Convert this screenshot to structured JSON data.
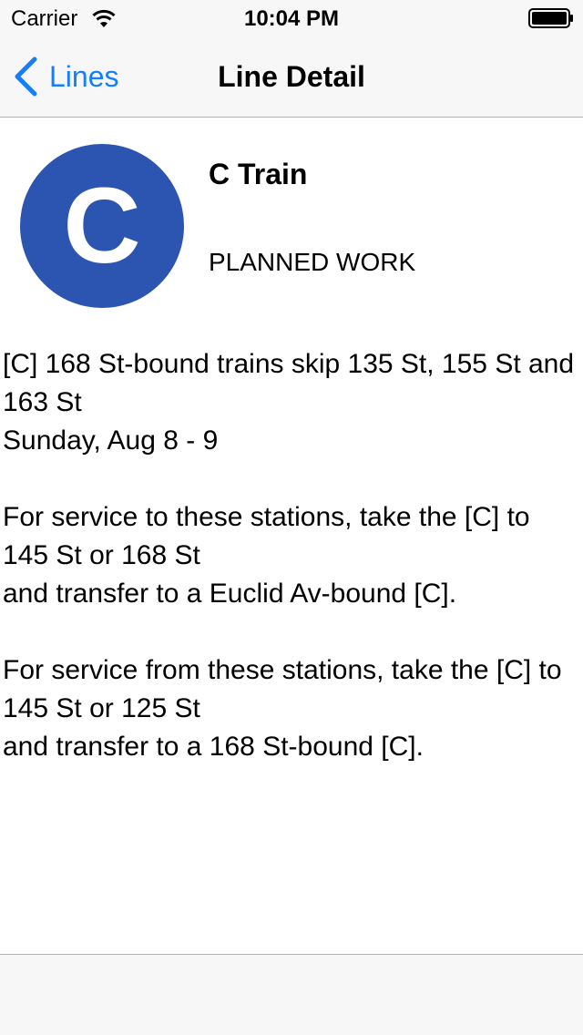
{
  "status_bar": {
    "carrier": "Carrier",
    "time": "10:04 PM",
    "icons": [
      "wifi-icon",
      "battery-icon"
    ]
  },
  "nav": {
    "back_label": "Lines",
    "title": "Line Detail",
    "back_icon": "chevron-left-icon",
    "accent_color": "#157efb"
  },
  "line": {
    "bullet_letter": "C",
    "bullet_color": "#2b55b0",
    "name": "C Train",
    "status": "PLANNED WORK"
  },
  "detail": {
    "text": "[C] 168 St-bound trains skip 135 St, 155 St and 163 St\nSunday, Aug 8 - 9\n\nFor service to these stations, take the [C] to 145 St or 168 St\nand transfer to a Euclid Av-bound [C].\n\nFor service from these stations, take the [C] to 145 St or 125 St\nand transfer to a 168 St-bound [C]."
  }
}
